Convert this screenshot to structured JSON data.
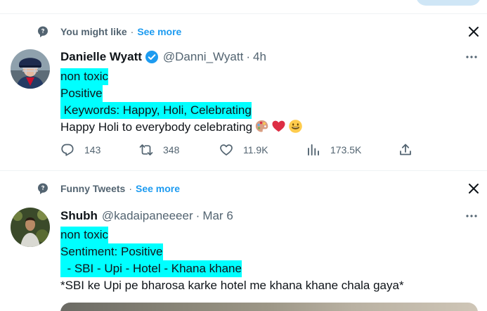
{
  "colors": {
    "highlight": "#00ffff",
    "accent": "#1d9bf0",
    "muted": "#536471",
    "text": "#0f1419",
    "like_heart": "#e0245e"
  },
  "tweets": [
    {
      "context": {
        "icon": "topic-bubble-icon",
        "label": "You might like",
        "separator": "·",
        "see_more": "See more"
      },
      "author": {
        "name": "Danielle Wyatt",
        "verified": true,
        "handle": "@Danni_Wyatt",
        "separator": "·",
        "time": "4h"
      },
      "lines": [
        {
          "text": "non toxic",
          "highlight": true
        },
        {
          "text": "Positive",
          "highlight": true
        },
        {
          "text": " Keywords: Happy, Holi, Celebrating",
          "highlight": true
        },
        {
          "text": "Happy Holi to everybody celebrating",
          "highlight": false,
          "emojis": [
            "artist-palette-icon",
            "red-heart-icon",
            "grinning-face-icon"
          ]
        }
      ],
      "stats": {
        "replies": "143",
        "retweets": "348",
        "likes": "11.9K",
        "views": "173.5K"
      }
    },
    {
      "context": {
        "icon": "topic-bubble-icon",
        "label": "Funny Tweets",
        "separator": "·",
        "see_more": "See more"
      },
      "author": {
        "name": "Shubh",
        "verified": false,
        "handle": "@kadaipaneeeer",
        "separator": "·",
        "time": "Mar 6"
      },
      "lines": [
        {
          "text": "non toxic",
          "highlight": true
        },
        {
          "text": "Sentiment: Positive",
          "highlight": true
        },
        {
          "text": "  - SBI - Upi - Hotel - Khana khane",
          "highlight": true
        },
        {
          "text": "*SBI ke Upi pe bharosa karke hotel me khana khane chala gaya*",
          "highlight": false
        }
      ]
    }
  ]
}
